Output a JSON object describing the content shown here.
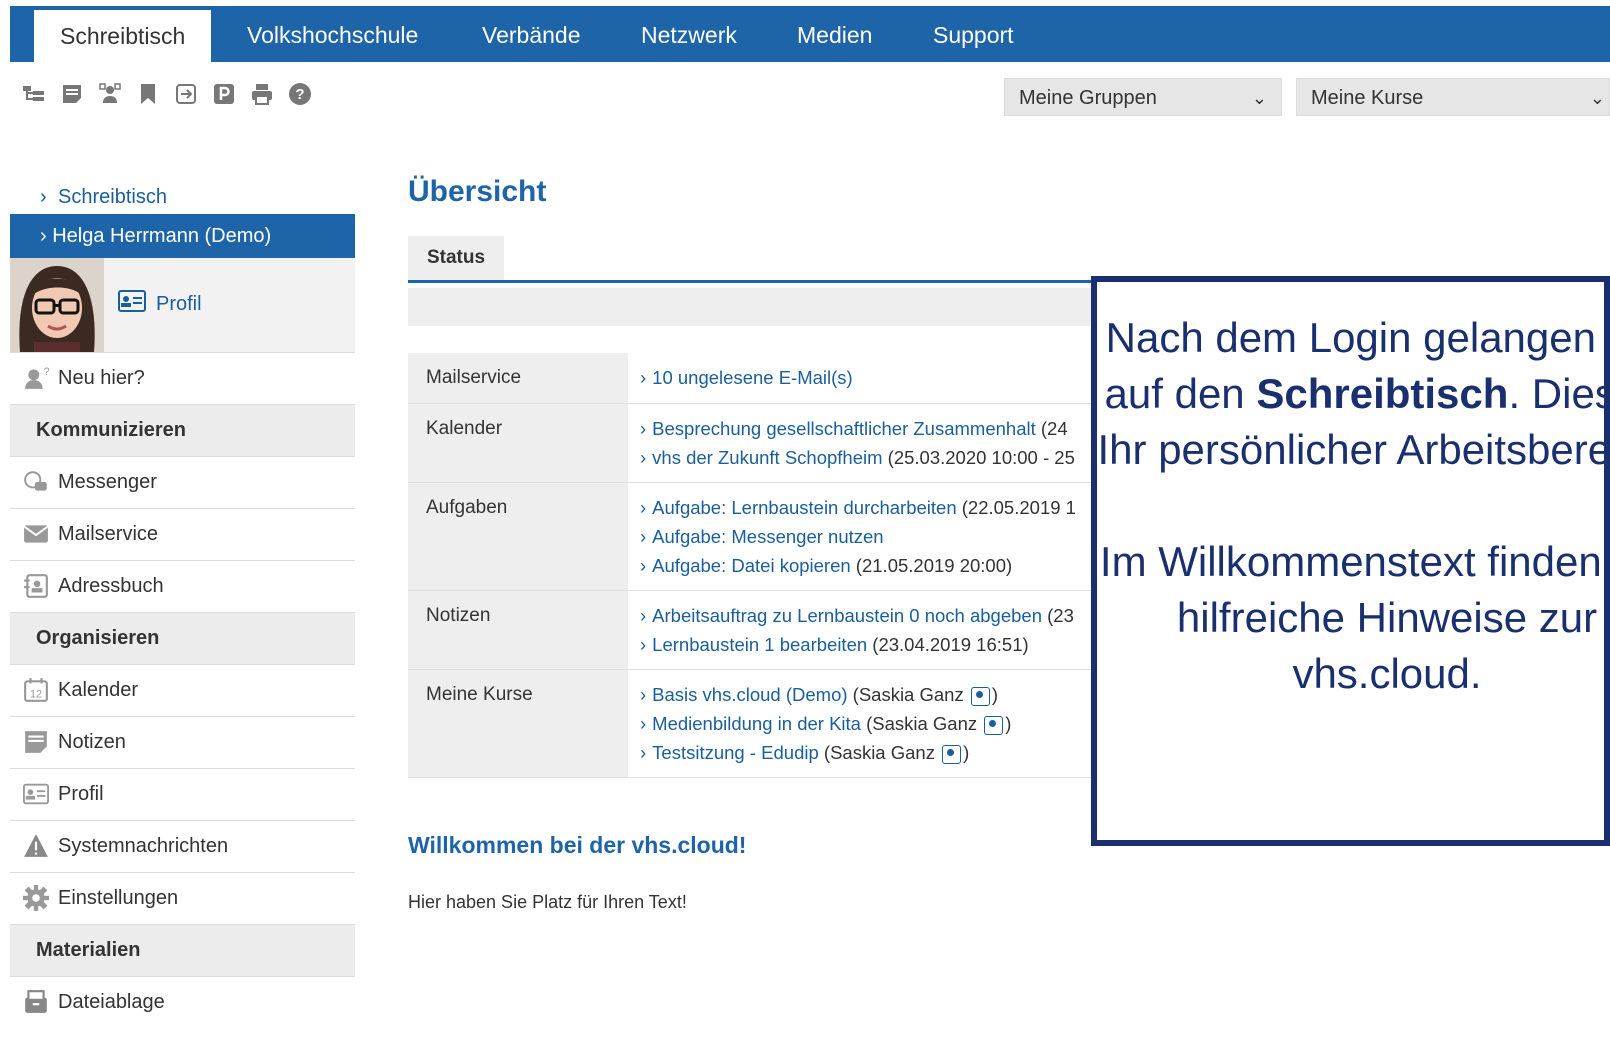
{
  "topnav": {
    "tabs": [
      "Schreibtisch",
      "Volkshochschule",
      "Verbände",
      "Netzwerk",
      "Medien",
      "Support"
    ],
    "active": "Schreibtisch"
  },
  "toolbar": {
    "icons": [
      "structure-icon",
      "notes-icon",
      "users-icon",
      "bookmark-icon",
      "export-icon",
      "parking-icon",
      "print-icon",
      "help-icon"
    ]
  },
  "selects": {
    "groups": "Meine Gruppen",
    "courses": "Meine Kurse"
  },
  "sidebar": {
    "crumb": "Schreibtisch",
    "user": "Helga Herrmann (Demo)",
    "profile_link": "Profil",
    "new_here": "Neu hier?",
    "sections": [
      {
        "heading": "Kommunizieren",
        "items": [
          "Messenger",
          "Mailservice",
          "Adressbuch"
        ]
      },
      {
        "heading": "Organisieren",
        "items": [
          "Kalender",
          "Notizen",
          "Profil",
          "Systemnachrichten",
          "Einstellungen"
        ]
      },
      {
        "heading": "Materialien",
        "items": [
          "Dateiablage"
        ]
      }
    ],
    "calendar_day": "12"
  },
  "main": {
    "title": "Übersicht",
    "status_tab": "Status",
    "rows": [
      {
        "label": "Mailservice",
        "lines": [
          {
            "link": "10 ungelesene E-Mail(s)",
            "rest": ""
          }
        ]
      },
      {
        "label": "Kalender",
        "lines": [
          {
            "link": "Besprechung gesellschaftlicher Zusammenhalt",
            "rest": " (24"
          },
          {
            "link": "vhs der Zukunft Schopfheim",
            "rest": " (25.03.2020 10:00 - 25"
          }
        ]
      },
      {
        "label": "Aufgaben",
        "lines": [
          {
            "link": "Aufgabe: Lernbaustein durcharbeiten",
            "rest": " (22.05.2019 1"
          },
          {
            "link": "Aufgabe: Messenger nutzen",
            "rest": ""
          },
          {
            "link": "Aufgabe: Datei kopieren",
            "rest": " (21.05.2019 20:00)"
          }
        ]
      },
      {
        "label": "Notizen",
        "lines": [
          {
            "link": "Arbeitsauftrag zu Lernbaustein 0 noch abgeben",
            "rest": " (23"
          },
          {
            "link": "Lernbaustein 1 bearbeiten",
            "rest": " (23.04.2019 16:51)"
          }
        ]
      },
      {
        "label": "Meine Kurse",
        "lines": [
          {
            "link": "Basis vhs.cloud (Demo)",
            "rest": " (Saskia Ganz ",
            "icon": true
          },
          {
            "link": "Medienbildung in der Kita",
            "rest": " (Saskia Ganz ",
            "icon": true
          },
          {
            "link": "Testsitzung - Edudip",
            "rest": " (Saskia Ganz ",
            "icon": true
          }
        ]
      }
    ],
    "welcome_title": "Willkommen bei der vhs.cloud!",
    "welcome_text": "Hier haben Sie Platz für Ihren Text!"
  },
  "callout": {
    "p1_a": "Nach dem Login gelangen Sie auf den",
    "p1_bold": "Schreibtisch",
    "p1_b": ". Dies ist Ihr persönlicher Arbeitsbereich.",
    "p2": "Im Willkommenstext finden Sie hilfreiche Hinweise zur vhs.cloud."
  },
  "colors": {
    "brand": "#1e64a8",
    "callout_border": "#1a2f6e"
  }
}
